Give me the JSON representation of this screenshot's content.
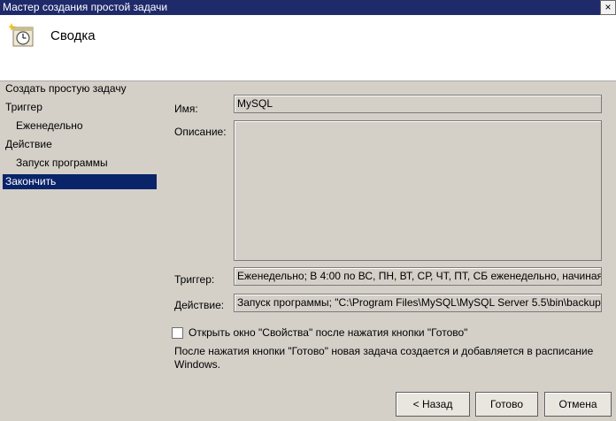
{
  "window": {
    "title": "Мастер создания простой задачи",
    "close_glyph": "×"
  },
  "header": {
    "title": "Сводка",
    "icon": "clock-task-icon"
  },
  "sidebar": {
    "items": [
      {
        "label": "Создать простую задачу",
        "sub": false,
        "selected": false
      },
      {
        "label": "Триггер",
        "sub": false,
        "selected": false
      },
      {
        "label": "Еженедельно",
        "sub": true,
        "selected": false
      },
      {
        "label": "Действие",
        "sub": false,
        "selected": false
      },
      {
        "label": "Запуск программы",
        "sub": true,
        "selected": false
      },
      {
        "label": "Закончить",
        "sub": false,
        "selected": true
      }
    ]
  },
  "summary": {
    "name_label": "Имя:",
    "name_value": "MySQL",
    "description_label": "Описание:",
    "description_value": "",
    "trigger_label": "Триггер:",
    "trigger_value": "Еженедельно; В 4:00 по ВС, ПН, ВТ, СР, ЧТ, ПТ, СБ еженедельно, начиная с",
    "action_label": "Действие:",
    "action_value": "Запуск программы; \"C:\\Program Files\\MySQL\\MySQL Server 5.5\\bin\\backup"
  },
  "options": {
    "open_properties_label": "Открыть окно \"Свойства\" после нажатия кнопки \"Готово\"",
    "open_properties_checked": false,
    "info": "После нажатия кнопки \"Готово\" новая задача создается и добавляется в расписание Windows."
  },
  "buttons": {
    "back": "< Назад",
    "finish": "Готово",
    "cancel": "Отмена"
  },
  "colors": {
    "title_bar": "#1f2a6b",
    "selected": "#0a246a",
    "panel": "#d4d0c8"
  }
}
